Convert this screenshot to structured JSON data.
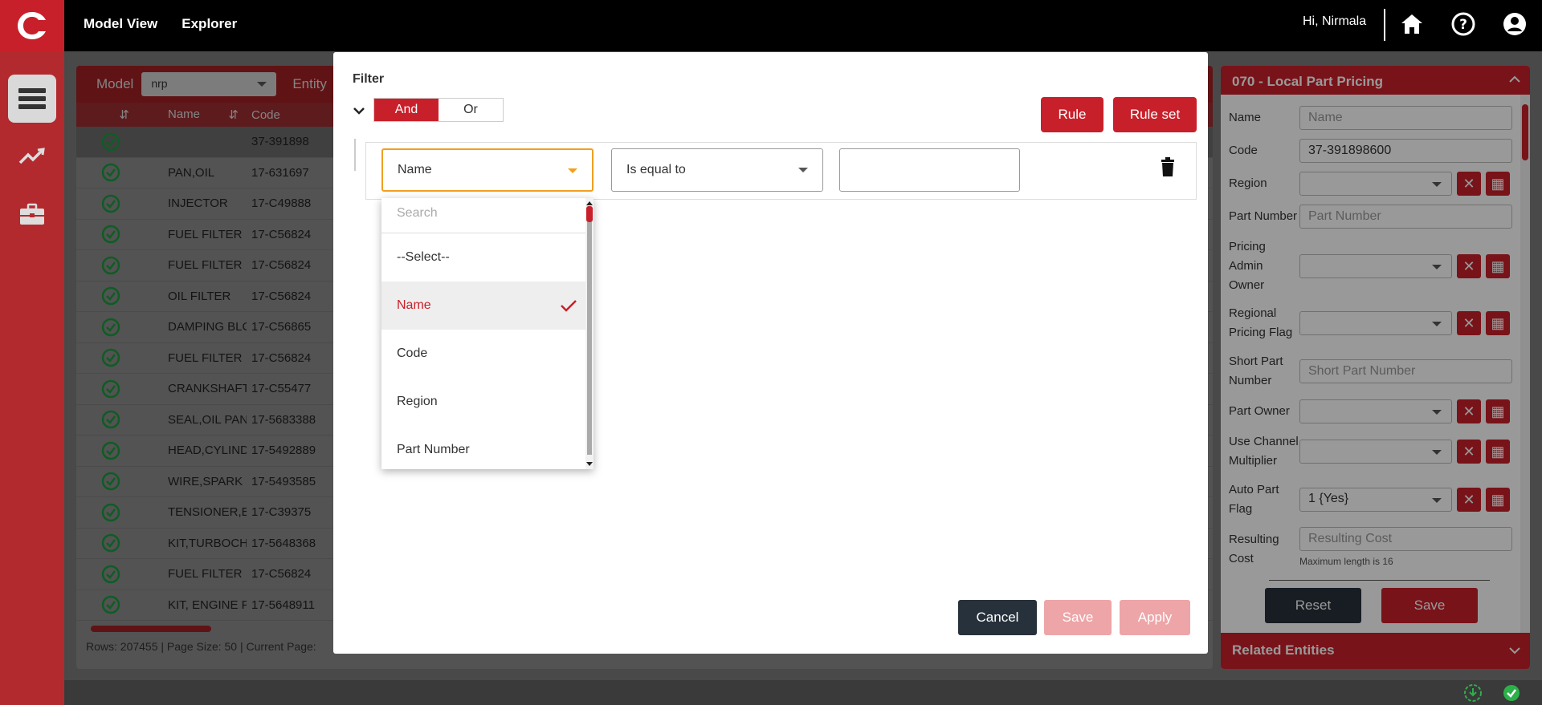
{
  "topbar": {
    "nav": [
      "Model View",
      "Explorer"
    ],
    "greeting": "Hi, Nirmala"
  },
  "sidebar": {
    "items": [
      "list-icon",
      "trend-icon",
      "briefcase-icon"
    ]
  },
  "left": {
    "model_label": "Model",
    "model_value": "nrp",
    "entity_label": "Entity",
    "columns": [
      "Name",
      "Code"
    ],
    "rows": [
      {
        "name": "",
        "code": "37-391898"
      },
      {
        "name": "PAN,OIL",
        "code": "17-631697"
      },
      {
        "name": "INJECTOR",
        "code": "17-C49888"
      },
      {
        "name": "FUEL FILTER",
        "code": "17-C56824"
      },
      {
        "name": "FUEL FILTER",
        "code": "17-C56824"
      },
      {
        "name": "OIL FILTER",
        "code": "17-C56824"
      },
      {
        "name": "DAMPING BLC",
        "code": "17-C56865"
      },
      {
        "name": "FUEL FILTER",
        "code": "17-C56824"
      },
      {
        "name": "CRANKSHAFT",
        "code": "17-C55477"
      },
      {
        "name": "SEAL,OIL PAN",
        "code": "17-5683388"
      },
      {
        "name": "HEAD,CYLIND",
        "code": "17-5492889"
      },
      {
        "name": "WIRE,SPARK F",
        "code": "17-5493585"
      },
      {
        "name": "TENSIONER,B",
        "code": "17-C39375"
      },
      {
        "name": "KIT,TURBOCH",
        "code": "17-5648368"
      },
      {
        "name": "FUEL FILTER",
        "code": "17-C56824"
      },
      {
        "name": "KIT, ENGINE P",
        "code": "17-5648911"
      }
    ],
    "pager": "Rows: 207455 | Page Size: 50 | Current Page:"
  },
  "filter": {
    "title": "Filter",
    "and_label": "And",
    "or_label": "Or",
    "rule_label": "Rule",
    "ruleset_label": "Rule set",
    "field_value": "Name",
    "operator_value": "Is equal to",
    "value_input": "",
    "search_placeholder": "Search",
    "options": [
      "--Select--",
      "Name",
      "Code",
      "Region",
      "Part Number"
    ],
    "selected_option": "Name",
    "cancel_label": "Cancel",
    "save_label": "Save",
    "apply_label": "Apply"
  },
  "right": {
    "title": "070 - Local Part Pricing",
    "footer": "Related Entities",
    "fields": {
      "name_label": "Name",
      "name_placeholder": "Name",
      "code_label": "Code",
      "code_value": "37-391898600",
      "region_label": "Region",
      "partnum_label": "Part Number",
      "partnum_placeholder": "Part Number",
      "pao_label": "Pricing Admin Owner",
      "rpf_label": "Regional Pricing Flag",
      "spn_label": "Short Part Number",
      "spn_placeholder": "Short Part Number",
      "owner_label": "Part Owner",
      "ucm_label": "Use Channel Multiplier",
      "apf_label": "Auto Part Flag",
      "apf_value": "1 {Yes}",
      "rc_label": "Resulting Cost",
      "rc_placeholder": "Resulting Cost",
      "rc_hint": "Maximum length is 16"
    },
    "reset_label": "Reset",
    "save_label": "Save"
  },
  "colors": {
    "brand": "#c8202a",
    "dark": "#27313b"
  }
}
